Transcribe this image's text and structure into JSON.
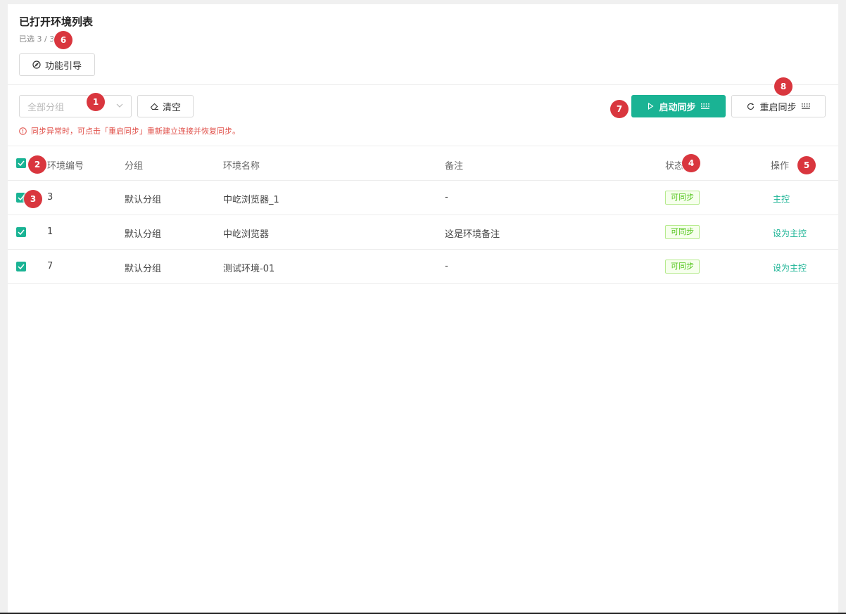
{
  "header": {
    "title": "已打开环境列表",
    "subtitle": "已选 3 / 3",
    "guide_label": "功能引导"
  },
  "toolbar": {
    "group_placeholder": "全部分组",
    "clear_label": "清空",
    "warning": "同步异常时，可点击「重启同步」重新建立连接并恢复同步。",
    "start_sync_label": "启动同步",
    "restart_sync_label": "重启同步"
  },
  "table": {
    "headers": [
      "环境编号",
      "分组",
      "环境名称",
      "备注",
      "状态",
      "操作"
    ],
    "rows": [
      {
        "id": "3",
        "group": "默认分组",
        "name": "中屹浏览器_1",
        "note": "-",
        "status": "可同步",
        "action": "主控"
      },
      {
        "id": "1",
        "group": "默认分组",
        "name": "中屹浏览器",
        "note": "这是环境备注",
        "status": "可同步",
        "action": "设为主控"
      },
      {
        "id": "7",
        "group": "默认分组",
        "name": "测试环境-01",
        "note": "-",
        "status": "可同步",
        "action": "设为主控"
      }
    ]
  },
  "badges": [
    "1",
    "2",
    "3",
    "4",
    "5",
    "6",
    "7",
    "8"
  ],
  "colors": {
    "accent": "#1ab394",
    "badge": "#d9363e",
    "warning": "#e0504a",
    "tag_green": "#52c41a"
  }
}
